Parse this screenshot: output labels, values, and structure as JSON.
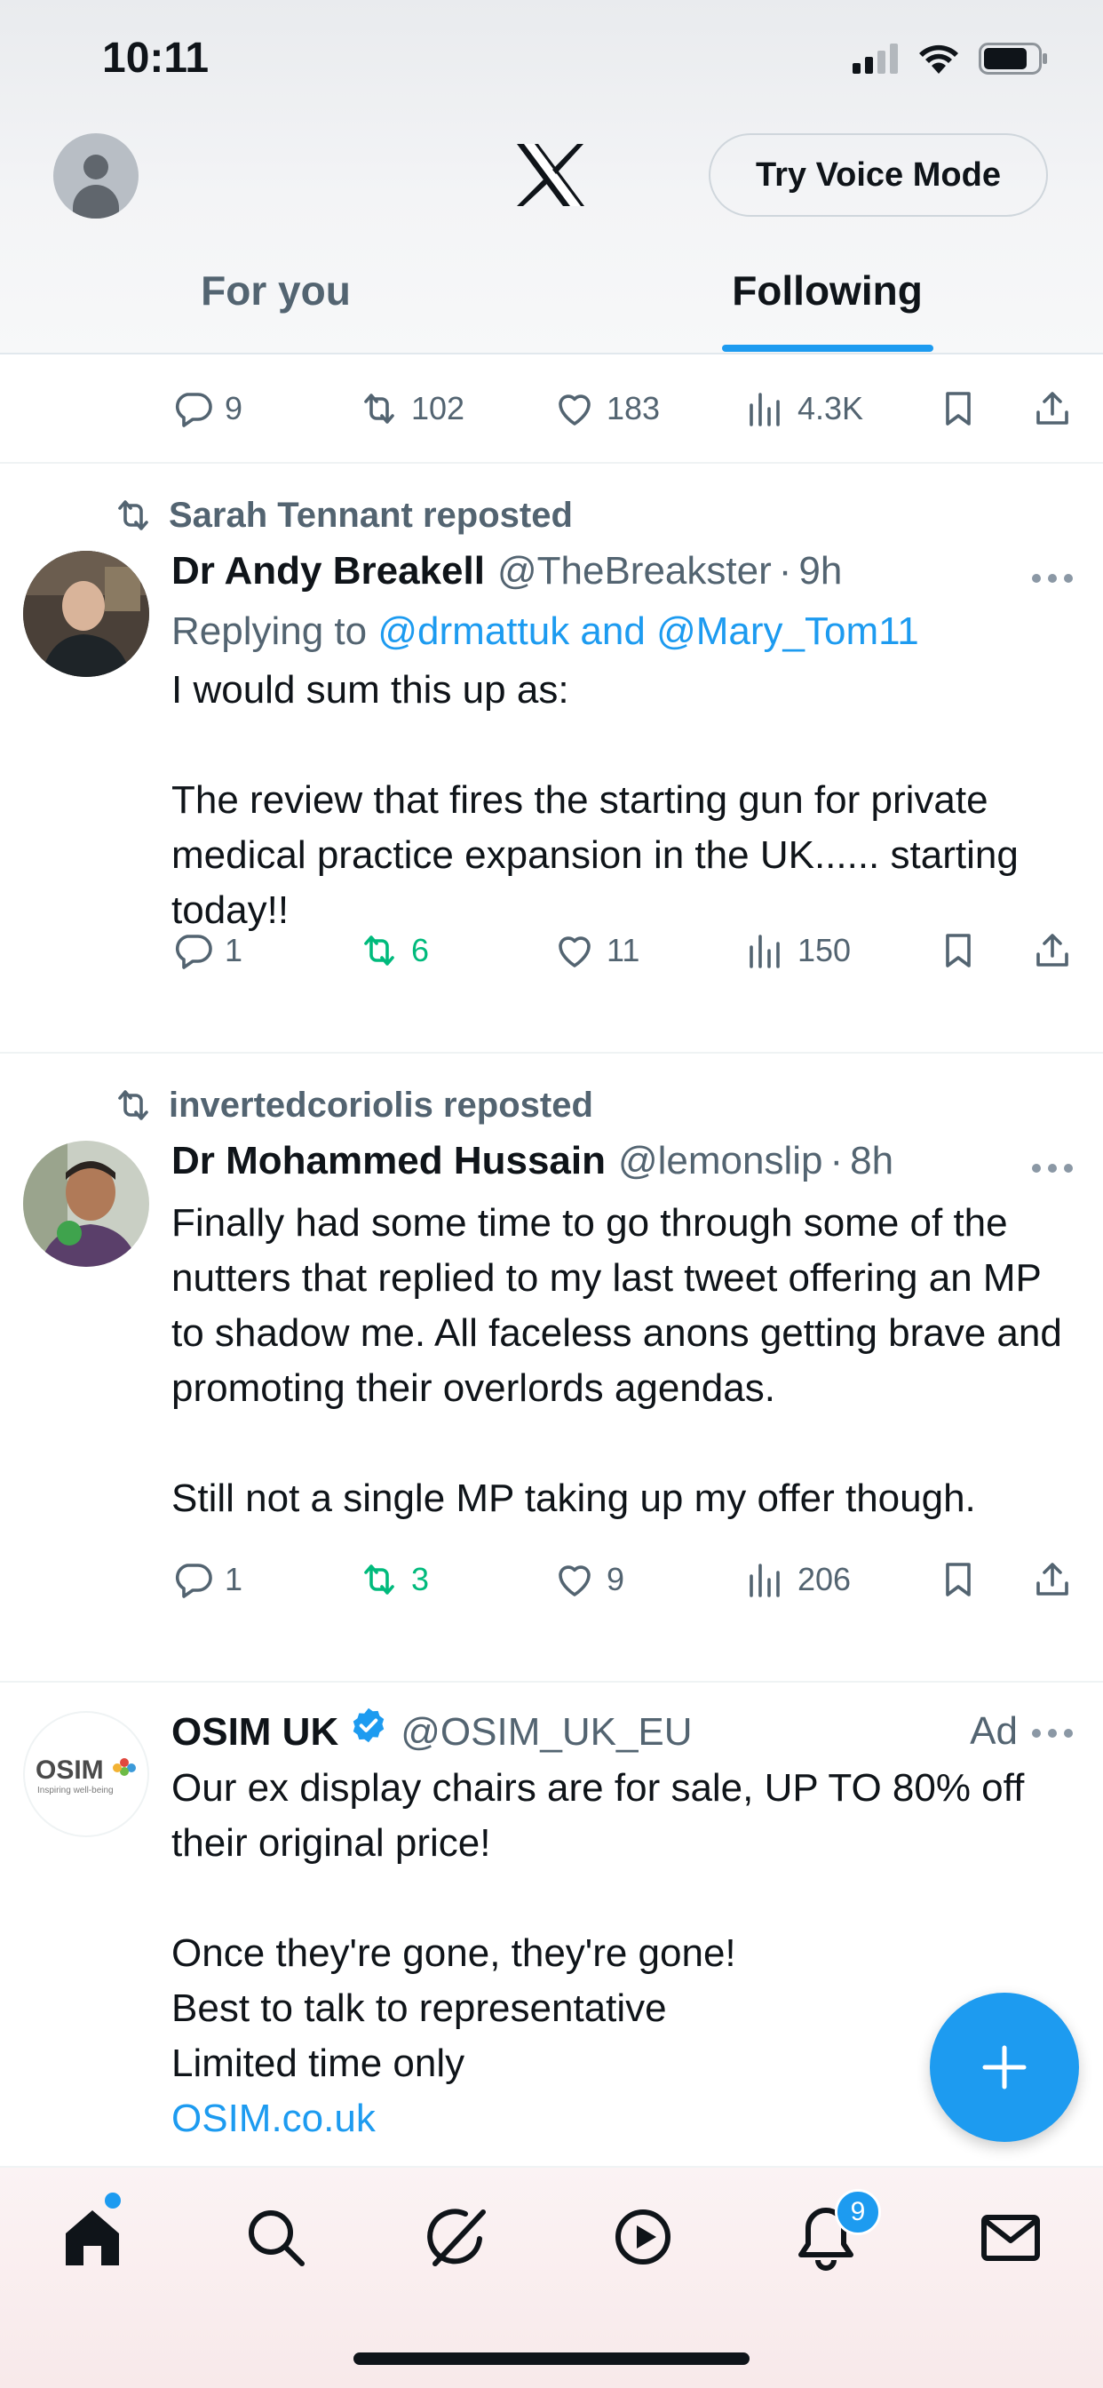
{
  "status_bar": {
    "time": "10:11"
  },
  "header": {
    "voice_mode_label": "Try Voice Mode",
    "tabs": [
      {
        "label": "For you",
        "active": false
      },
      {
        "label": "Following",
        "active": true
      }
    ]
  },
  "colors": {
    "accent": "#1d9bf0",
    "repost_green": "#00ba7c",
    "muted": "#536471"
  },
  "top_partial_tweet": {
    "actions": {
      "replies": "9",
      "reposts": "102",
      "likes": "183",
      "views": "4.3K"
    }
  },
  "tweets": [
    {
      "reposted_by": "Sarah Tennant reposted",
      "name": "Dr Andy Breakell",
      "handle": "@TheBreakster",
      "age": "9h",
      "replying_prefix": "Replying to",
      "replying_to": "@drmattuk and @Mary_Tom11",
      "body": [
        "I would sum this up as:",
        "",
        "The review that fires the starting gun for private medical practice expansion in the UK...... starting today!!"
      ],
      "actions": {
        "replies": "1",
        "reposts": "6",
        "likes": "11",
        "views": "150"
      }
    },
    {
      "reposted_by": "invertedcoriolis reposted",
      "name": "Dr Mohammed Hussain",
      "handle": "@lemonslip",
      "age": "8h",
      "body": [
        "Finally had some time to go through some of the nutters that replied to my last tweet offering an MP to shadow me. All faceless anons getting brave and promoting their overlords agendas.",
        "",
        "Still not a single MP taking up my offer though."
      ],
      "actions": {
        "replies": "1",
        "reposts": "3",
        "likes": "9",
        "views": "206"
      }
    },
    {
      "name": "OSIM UK",
      "handle": "@OSIM_UK_EU",
      "ad_label": "Ad",
      "avatar_logo": "OSIM",
      "avatar_tagline": "Inspiring well-being",
      "body": [
        "Our ex display chairs are for sale, UP TO 80% off their original price!",
        "",
        "Once they're gone, they're gone!",
        "Best to talk to representative",
        "Limited time only"
      ],
      "link": "OSIM.co.uk"
    }
  ],
  "bottom_nav": {
    "items": [
      "home-icon",
      "search-icon",
      "grok-icon",
      "video-icon",
      "notifications-icon",
      "messages-icon"
    ],
    "notification_count": "9"
  }
}
